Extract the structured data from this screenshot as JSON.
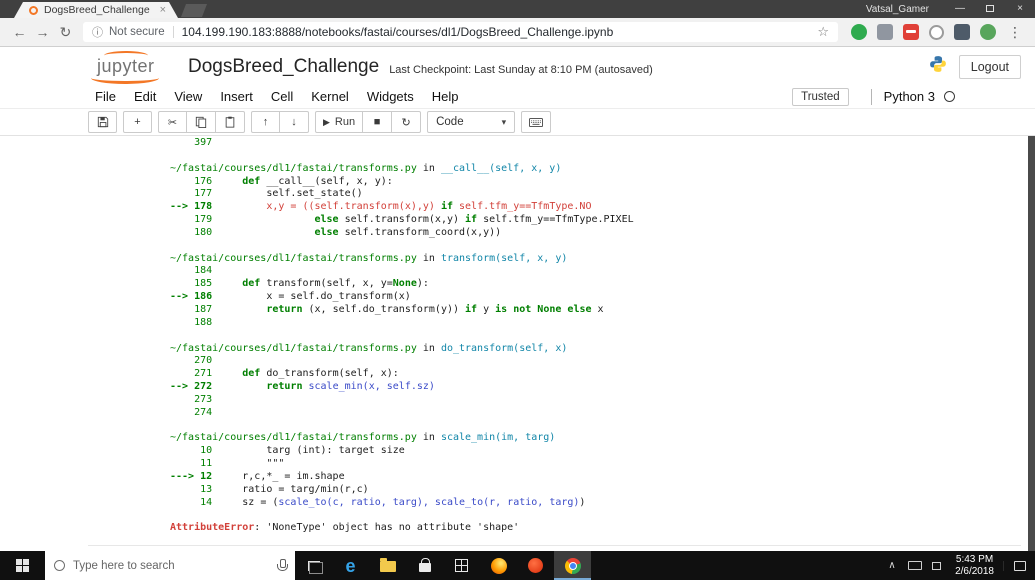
{
  "window": {
    "profile_name": "Vatsal_Gamer",
    "tab_title": "DogsBreed_Challenge"
  },
  "browser": {
    "security_label": "Not secure",
    "url": "104.199.190.183:8888/notebooks/fastai/courses/dl1/DogsBreed_Challenge.ipynb"
  },
  "icons": {
    "back": "←",
    "forward": "→",
    "reload": "↻",
    "info": "ⓘ",
    "star": "☆",
    "menu": "⋮",
    "tab_close": "×",
    "minimize": "—",
    "close": "×",
    "add": "+",
    "cut": "✂",
    "up": "↑",
    "down": "↓",
    "run": "▶",
    "stop": "■",
    "restart": "↻",
    "dropdown": "▾",
    "chevron_up": "∧",
    "edge": "e"
  },
  "notebook": {
    "brand": "jupyter",
    "title": "DogsBreed_Challenge",
    "checkpoint": "Last Checkpoint: Last Sunday at 8:10 PM",
    "autosave": "(autosaved)",
    "logout_label": "Logout",
    "menu_items": [
      "File",
      "Edit",
      "View",
      "Insert",
      "Cell",
      "Kernel",
      "Widgets",
      "Help"
    ],
    "trusted_label": "Trusted",
    "kernel_name": "Python 3",
    "run_label": "Run",
    "cell_type_value": "Code"
  },
  "colors": {
    "jupyter_orange": "#f37726",
    "traceback_green": "#007f00",
    "traceback_cyan": "#1286a8",
    "traceback_red": "#d2413a",
    "traceback_blue": "#3b4bc8"
  },
  "traceback": {
    "palette": {
      "k": "#1e1e1e",
      "g": "#007f00",
      "c": "#1286a8",
      "r": "#d2413a",
      "b": "#3b4bc8"
    },
    "lines": [
      [
        {
          "t": "    397 ",
          "c": "g"
        }
      ],
      [],
      [
        {
          "t": "~/fastai/courses/dl1/fastai/transforms.py",
          "c": "g"
        },
        {
          "t": " in ",
          "c": "k"
        },
        {
          "t": "__call__(self, x, y)",
          "c": "c"
        }
      ],
      [
        {
          "t": "    176 ",
          "c": "g"
        },
        {
          "t": "    ",
          "c": "k"
        },
        {
          "t": "def",
          "c": "g",
          "f": 1
        },
        {
          "t": " __call__(self, x, y):",
          "c": "k"
        }
      ],
      [
        {
          "t": "    177 ",
          "c": "g"
        },
        {
          "t": "        self.set_state()",
          "c": "k"
        }
      ],
      [
        {
          "t": "--> 178 ",
          "c": "g",
          "f": 1
        },
        {
          "t": "        ",
          "c": "k"
        },
        {
          "t": "x,y = ((self.transform(x),y) ",
          "c": "r"
        },
        {
          "t": "if",
          "c": "g",
          "f": 1
        },
        {
          "t": " self.tfm_y==TfmType.NO",
          "c": "r"
        }
      ],
      [
        {
          "t": "    179 ",
          "c": "g"
        },
        {
          "t": "                ",
          "c": "k"
        },
        {
          "t": "else",
          "c": "g",
          "f": 1
        },
        {
          "t": " self.transform(x,y) ",
          "c": "k"
        },
        {
          "t": "if",
          "c": "g",
          "f": 1
        },
        {
          "t": " self.tfm_y==TfmType.PIXEL",
          "c": "k"
        }
      ],
      [
        {
          "t": "    180 ",
          "c": "g"
        },
        {
          "t": "                ",
          "c": "k"
        },
        {
          "t": "else",
          "c": "g",
          "f": 1
        },
        {
          "t": " self.transform_coord(x,y))",
          "c": "k"
        }
      ],
      [],
      [
        {
          "t": "~/fastai/courses/dl1/fastai/transforms.py",
          "c": "g"
        },
        {
          "t": " in ",
          "c": "k"
        },
        {
          "t": "transform(self, x, y)",
          "c": "c"
        }
      ],
      [
        {
          "t": "    184 ",
          "c": "g"
        }
      ],
      [
        {
          "t": "    185 ",
          "c": "g"
        },
        {
          "t": "    ",
          "c": "k"
        },
        {
          "t": "def",
          "c": "g",
          "f": 1
        },
        {
          "t": " transform(self, x, y=",
          "c": "k"
        },
        {
          "t": "None",
          "c": "g",
          "f": 1
        },
        {
          "t": "):",
          "c": "k"
        }
      ],
      [
        {
          "t": "--> 186 ",
          "c": "g",
          "f": 1
        },
        {
          "t": "        x = self.do_transform(x)",
          "c": "k"
        }
      ],
      [
        {
          "t": "    187 ",
          "c": "g"
        },
        {
          "t": "        ",
          "c": "k"
        },
        {
          "t": "return",
          "c": "g",
          "f": 1
        },
        {
          "t": " (x, self.do_transform(y)) ",
          "c": "k"
        },
        {
          "t": "if",
          "c": "g",
          "f": 1
        },
        {
          "t": " y ",
          "c": "k"
        },
        {
          "t": "is not",
          "c": "g",
          "f": 1
        },
        {
          "t": " ",
          "c": "k"
        },
        {
          "t": "None",
          "c": "g",
          "f": 1
        },
        {
          "t": " ",
          "c": "k"
        },
        {
          "t": "else",
          "c": "g",
          "f": 1
        },
        {
          "t": " x",
          "c": "k"
        }
      ],
      [
        {
          "t": "    188 ",
          "c": "g"
        }
      ],
      [],
      [
        {
          "t": "~/fastai/courses/dl1/fastai/transforms.py",
          "c": "g"
        },
        {
          "t": " in ",
          "c": "k"
        },
        {
          "t": "do_transform(self, x)",
          "c": "c"
        }
      ],
      [
        {
          "t": "    270 ",
          "c": "g"
        }
      ],
      [
        {
          "t": "    271 ",
          "c": "g"
        },
        {
          "t": "    ",
          "c": "k"
        },
        {
          "t": "def",
          "c": "g",
          "f": 1
        },
        {
          "t": " do_transform(self, x):",
          "c": "k"
        }
      ],
      [
        {
          "t": "--> 272 ",
          "c": "g",
          "f": 1
        },
        {
          "t": "        ",
          "c": "k"
        },
        {
          "t": "return",
          "c": "g",
          "f": 1
        },
        {
          "t": " scale_min(x, self.sz)",
          "c": "b"
        }
      ],
      [
        {
          "t": "    273 ",
          "c": "g"
        }
      ],
      [
        {
          "t": "    274 ",
          "c": "g"
        }
      ],
      [],
      [
        {
          "t": "~/fastai/courses/dl1/fastai/transforms.py",
          "c": "g"
        },
        {
          "t": " in ",
          "c": "k"
        },
        {
          "t": "scale_min(im, targ)",
          "c": "c"
        }
      ],
      [
        {
          "t": "     10 ",
          "c": "g"
        },
        {
          "t": "        targ (int): target size",
          "c": "k"
        }
      ],
      [
        {
          "t": "     11 ",
          "c": "g"
        },
        {
          "t": "        \"\"\"",
          "c": "k"
        }
      ],
      [
        {
          "t": "---> 12 ",
          "c": "g",
          "f": 1
        },
        {
          "t": "    r,c,*_ = im.shape",
          "c": "k"
        }
      ],
      [
        {
          "t": "     13 ",
          "c": "g"
        },
        {
          "t": "    ratio = targ/min(r,c)",
          "c": "k"
        }
      ],
      [
        {
          "t": "     14 ",
          "c": "g"
        },
        {
          "t": "    sz = (",
          "c": "k"
        },
        {
          "t": "scale_to(c, ratio, targ), scale_to(r, ratio, targ)",
          "c": "b"
        },
        {
          "t": ")",
          "c": "k"
        }
      ],
      [],
      [
        {
          "t": "AttributeError",
          "c": "r",
          "f": 1
        },
        {
          "t": ": 'NoneType' object has no attribute 'shape'",
          "c": "k"
        }
      ]
    ]
  },
  "taskbar": {
    "search_placeholder": "Type here to search",
    "clock_time": "5:43 PM",
    "clock_date": "2/6/2018"
  }
}
